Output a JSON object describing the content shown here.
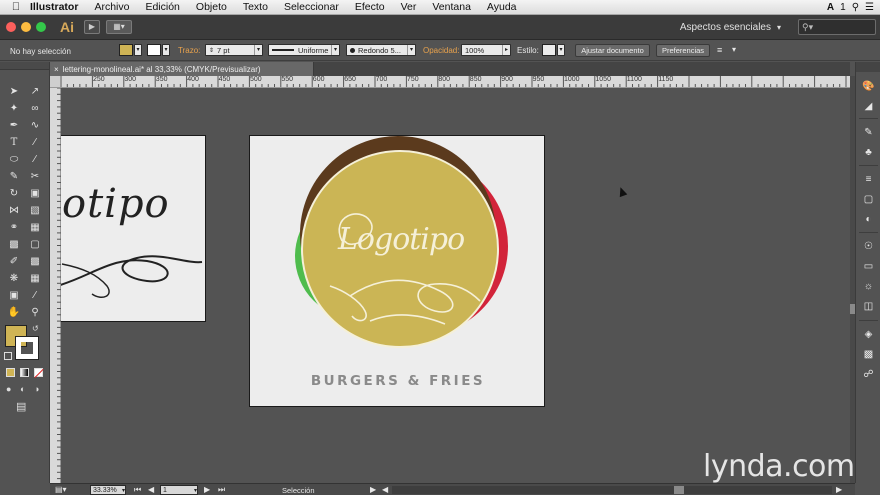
{
  "menubar": {
    "items": [
      "Illustrator",
      "Archivo",
      "Edición",
      "Objeto",
      "Texto",
      "Seleccionar",
      "Efecto",
      "Ver",
      "Ventana",
      "Ayuda"
    ],
    "right_badge": "1"
  },
  "appbar": {
    "logo": "Ai",
    "workspace": "Aspectos esenciales",
    "colors": {
      "close": "#fc605c",
      "minimize": "#fdbc40",
      "zoom": "#34c84a"
    }
  },
  "control": {
    "selection": "No hay selección",
    "fill_color": "#cfb455",
    "stroke_label": "Trazo:",
    "stroke_value": "7 pt",
    "profile": "Uniforme",
    "brush": "Redondo 5...",
    "opacity_label": "Opacidad:",
    "opacity_value": "100%",
    "style_label": "Estilo:",
    "doc_button": "Ajustar documento",
    "prefs_button": "Preferencias"
  },
  "document": {
    "tab_title": "lettering-monolineal.ai* al 33,33% (CMYK/Previsualizar)"
  },
  "ruler": {
    "ticks": [
      "250",
      "300",
      "350",
      "400",
      "450",
      "500",
      "550",
      "600",
      "650",
      "700",
      "750",
      "800",
      "850",
      "900",
      "950",
      "1000",
      "1050",
      "1100",
      "1150"
    ]
  },
  "artwork": {
    "left_text": "otipo",
    "logo_script": "Logotipo",
    "tagline": "BURGERS & FRIES",
    "colors": {
      "gold": "#cbb555",
      "brown": "#5b3a1d",
      "red": "#d2243a",
      "green": "#4fbc4d",
      "cream": "#f5f0d8",
      "tagline": "#8a8a8a"
    }
  },
  "status": {
    "zoom": "33.33%",
    "page": "1",
    "mode": "Selección"
  },
  "watermark": "lynda.com"
}
